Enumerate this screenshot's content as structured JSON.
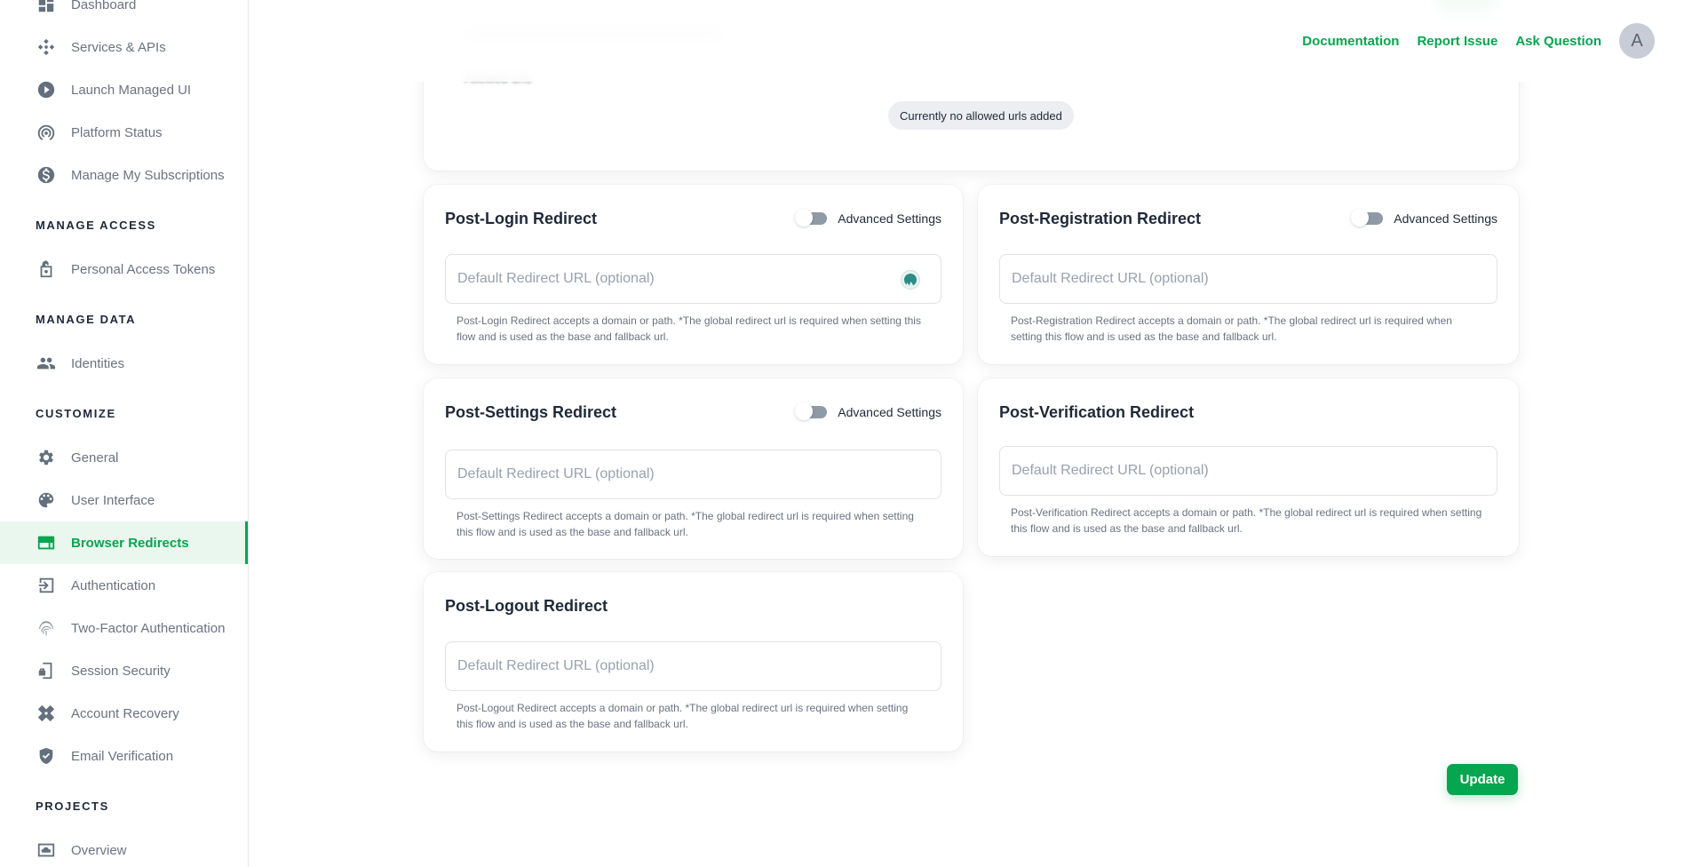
{
  "header": {
    "links": [
      "Documentation",
      "Report Issue",
      "Ask Question"
    ],
    "avatar_initial": "A"
  },
  "sidebar": {
    "items": [
      {
        "label": "Dashboard",
        "icon": "dashboard-icon"
      },
      {
        "label": "Services & APIs",
        "icon": "services-icon"
      },
      {
        "label": "Launch Managed UI",
        "icon": "play-icon"
      },
      {
        "label": "Platform Status",
        "icon": "broadcast-icon"
      },
      {
        "label": "Manage My Subscriptions",
        "icon": "dollar-icon"
      }
    ],
    "sections": [
      {
        "title": "MANAGE ACCESS",
        "items": [
          {
            "label": "Personal Access Tokens",
            "icon": "lock-icon"
          }
        ]
      },
      {
        "title": "MANAGE DATA",
        "items": [
          {
            "label": "Identities",
            "icon": "users-icon"
          }
        ]
      },
      {
        "title": "CUSTOMIZE",
        "items": [
          {
            "label": "General",
            "icon": "gear-icon"
          },
          {
            "label": "User Interface",
            "icon": "palette-icon"
          },
          {
            "label": "Browser Redirects",
            "icon": "browser-icon",
            "active": true
          },
          {
            "label": "Authentication",
            "icon": "login-icon"
          },
          {
            "label": "Two-Factor Authentication",
            "icon": "fingerprint-icon"
          },
          {
            "label": "Session Security",
            "icon": "phone-lock-icon"
          },
          {
            "label": "Account Recovery",
            "icon": "bandage-icon"
          },
          {
            "label": "Email Verification",
            "icon": "shield-check-icon"
          }
        ]
      },
      {
        "title": "PROJECTS",
        "items": [
          {
            "label": "Overview",
            "icon": "cloud-icon"
          }
        ]
      }
    ],
    "accent_color": "#06a550"
  },
  "allowed_urls": {
    "label": "Allowed urls",
    "empty_badge": "Currently no allowed urls added"
  },
  "redirects": [
    {
      "title": "Post-Login Redirect",
      "advanced_toggle": true,
      "advanced_label": "Advanced Settings",
      "advanced_on": false,
      "placeholder": "Default Redirect URL (optional)",
      "value": "",
      "helper": "Post-Login Redirect accepts a domain or path. *The global redirect url is required when setting this flow and is used as the base and fallback url."
    },
    {
      "title": "Post-Registration Redirect",
      "advanced_toggle": true,
      "advanced_label": "Advanced Settings",
      "advanced_on": false,
      "placeholder": "Default Redirect URL (optional)",
      "value": "",
      "helper": "Post-Registration Redirect accepts a domain or path. *The global redirect url is required when setting this flow and is used as the base and fallback url."
    },
    {
      "title": "Post-Settings Redirect",
      "advanced_toggle": true,
      "advanced_label": "Advanced Settings",
      "advanced_on": false,
      "placeholder": "Default Redirect URL (optional)",
      "value": "",
      "helper": "Post-Settings Redirect accepts a domain or path. *The global redirect url is required when setting this flow and is used as the base and fallback url."
    },
    {
      "title": "Post-Verification Redirect",
      "advanced_toggle": false,
      "placeholder": "Default Redirect URL (optional)",
      "value": "",
      "helper": "Post-Verification Redirect accepts a domain or path. *The global redirect url is required when setting this flow and is used as the base and fallback url."
    },
    {
      "title": "Post-Logout Redirect",
      "advanced_toggle": false,
      "placeholder": "Default Redirect URL (optional)",
      "value": "",
      "helper": "Post-Logout Redirect accepts a domain or path. *The global redirect url is required when setting this flow and is used as the base and fallback url."
    }
  ],
  "actions": {
    "update_label": "Update"
  }
}
